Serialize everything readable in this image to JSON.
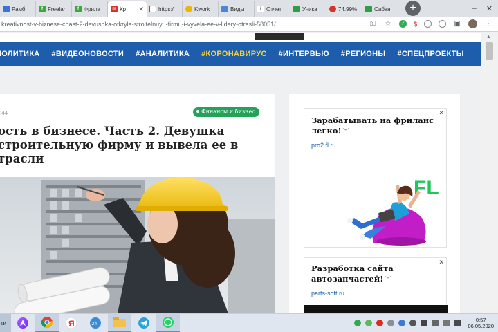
{
  "browser": {
    "tabs": [
      {
        "label": "Рамб",
        "color": "#3b73d6",
        "glyph": ""
      },
      {
        "label": "Freelar",
        "color": "#3ca83c",
        "glyph": "f"
      },
      {
        "label": "Фрила",
        "color": "#3ca83c",
        "glyph": "f"
      },
      {
        "label": "Кр",
        "color": "#d6332b",
        "glyph": "m",
        "active": true
      },
      {
        "label": "https:/",
        "color": "#d6332b",
        "glyph": ""
      },
      {
        "label": "Kwork",
        "color": "#f0b400",
        "glyph": ""
      },
      {
        "label": "Виды",
        "color": "#4a87d9",
        "glyph": ""
      },
      {
        "label": "Отчет",
        "color": "#ffffff",
        "glyph": "i"
      },
      {
        "label": "Уника",
        "color": "#2e9e46",
        "glyph": ""
      },
      {
        "label": "74.99%",
        "color": "#d6332b",
        "glyph": ""
      },
      {
        "label": "Сабан",
        "color": "#2e9e46",
        "glyph": ""
      }
    ],
    "new_tab": "+",
    "url": "kreativnost-v-biznese-chast-2-devushka-otkryla-stroitelnuyu-firmu-i-vyvela-ee-v-lidery-otrasli-58051/"
  },
  "nav": {
    "items": [
      "ПОЛИТИКА",
      "#ВИДЕОНОВОСТИ",
      "#АНАЛИТИКА",
      "#КОРОНАВИРУС",
      "#ИНТЕРВЬЮ",
      "#РЕГИОНЫ",
      "#СПЕЦПРОЕКТЫ"
    ],
    "highlight_index": 3,
    "bg_color": "#1e5dab",
    "highlight_color": "#f5d33a"
  },
  "article": {
    "date": ":44",
    "category": "Финансы и бизнес",
    "category_color": "#25a25a",
    "title_lines": [
      "ость в бизнесе. Часть 2. Девушка",
      "строительную фирму и вывела ее в",
      "трасли"
    ]
  },
  "ads": [
    {
      "title": "Зарабатывать на фриланс легко!",
      "link": "pro2.fl.ru",
      "logo_text": "FL"
    },
    {
      "title": "Разработка сайта автозапчастей!",
      "link": "parts-soft.ru"
    }
  ],
  "taskbar": {
    "start_text": "ти",
    "time": "0:57",
    "date": "06.05.2020"
  }
}
